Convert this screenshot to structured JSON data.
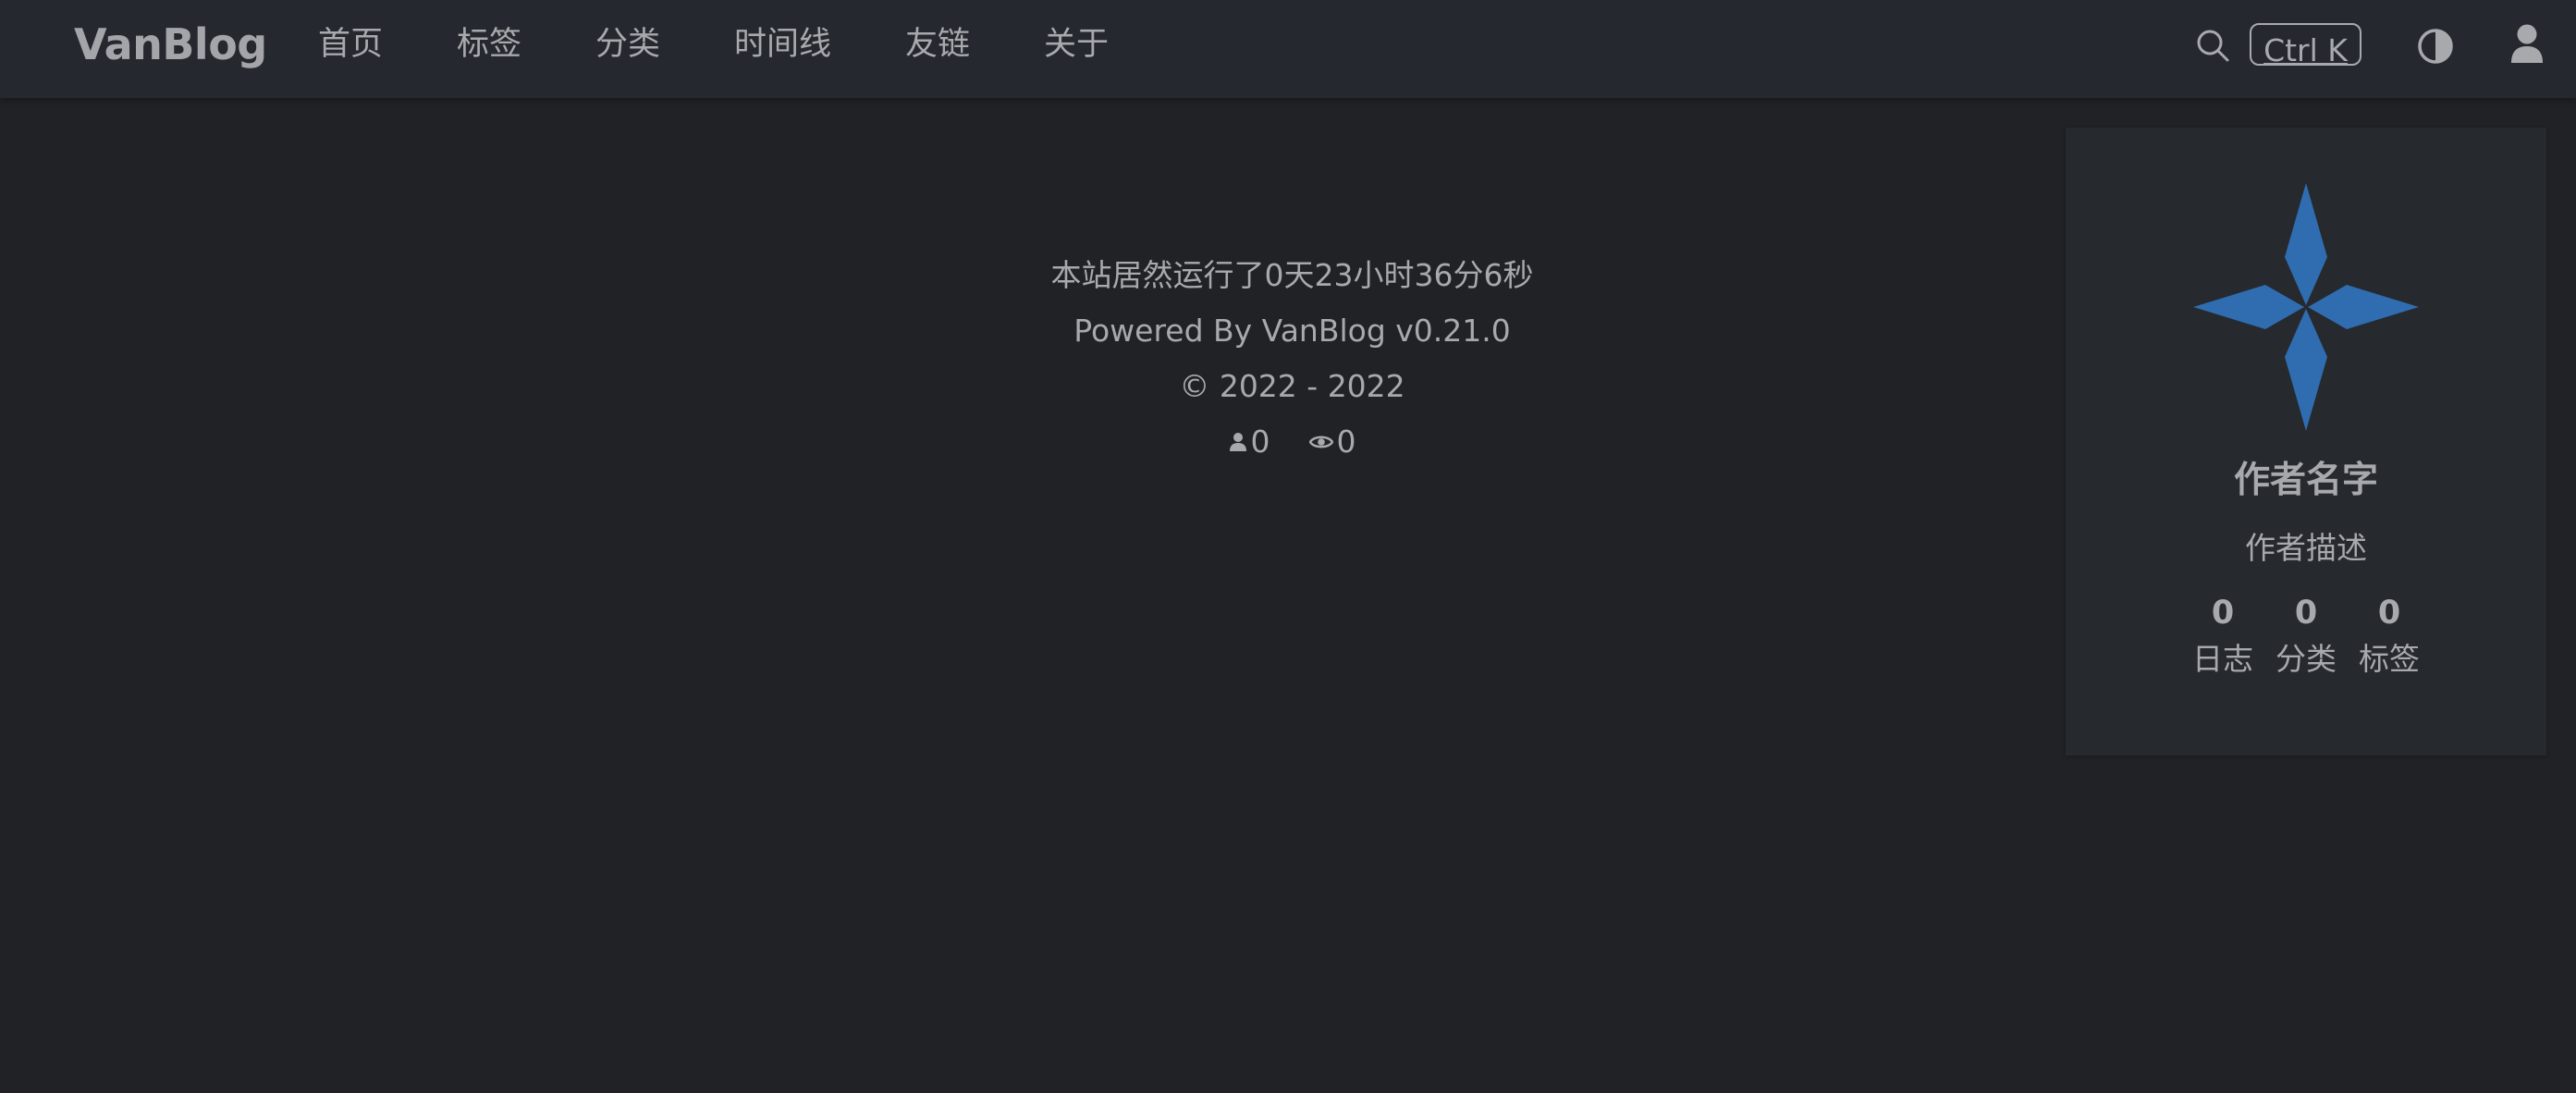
{
  "header": {
    "brand": "VanBlog",
    "nav": [
      {
        "label": "首页"
      },
      {
        "label": "标签"
      },
      {
        "label": "分类"
      },
      {
        "label": "时间线"
      },
      {
        "label": "友链"
      },
      {
        "label": "关于"
      }
    ],
    "search_shortcut": "Ctrl K",
    "icons": {
      "search": "search-icon",
      "theme": "theme-toggle-icon",
      "user": "user-icon"
    }
  },
  "footer": {
    "uptime": "本站居然运行了0天23小时36分6秒",
    "powered_by": "Powered By VanBlog v0.21.0",
    "copyright": "© 2022 - 2022",
    "visitors": "0",
    "views": "0"
  },
  "author_card": {
    "name": "作者名字",
    "description": "作者描述",
    "stats": [
      {
        "value": "0",
        "label": "日志"
      },
      {
        "value": "0",
        "label": "分类"
      },
      {
        "value": "0",
        "label": "标签"
      }
    ],
    "accent_color": "#2f6db0"
  },
  "colors": {
    "background": "#202226",
    "navbar": "#25282e",
    "card": "#26292e",
    "text": "#a7a9ad"
  }
}
